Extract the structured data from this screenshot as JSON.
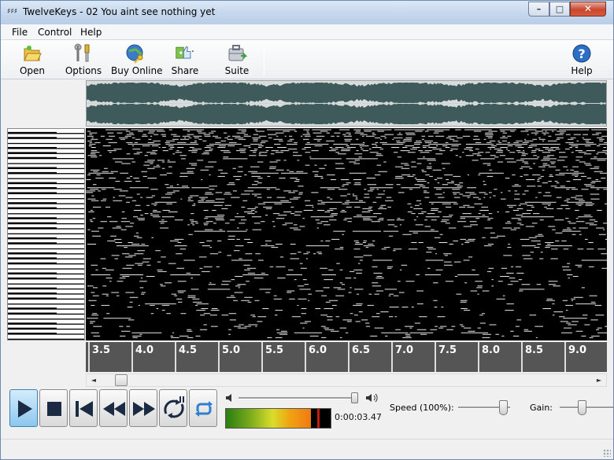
{
  "window": {
    "title": "TwelveKeys - 02 You aint see nothing yet",
    "app_icon_text": "♯♯♯",
    "minimize_glyph": "–",
    "maximize_glyph": "□",
    "close_glyph": "✕"
  },
  "menu": [
    "File",
    "Control",
    "Help"
  ],
  "toolbar": {
    "open": "Open",
    "options": "Options",
    "buy_online": "Buy Online",
    "share": "Share",
    "suite": "Suite",
    "help": "Help",
    "icons": [
      "folder-open-icon",
      "wrench-icon",
      "globe-key-icon",
      "thumbs-up-icon",
      "toolbox-icon",
      "help-icon"
    ]
  },
  "timeline": {
    "labels": [
      "3.5",
      "4.0",
      "4.5",
      "5.0",
      "5.5",
      "6.0",
      "6.5",
      "7.0",
      "7.5",
      "8.0",
      "8.5",
      "9.0"
    ]
  },
  "scroll": {
    "left_arrow": "◄",
    "right_arrow": "►",
    "position_fraction": 0.03
  },
  "transport": {
    "buttons": [
      "play",
      "stop",
      "skip-back",
      "rewind",
      "fast-forward",
      "loop-section",
      "repeat"
    ]
  },
  "volume": {
    "level_fraction": 0.95
  },
  "meter": {
    "level_fraction": 0.81,
    "peak_fraction": 0.87
  },
  "playback": {
    "time": "0:00:03.47"
  },
  "speed": {
    "label": "Speed (100%):",
    "value_percent": 100
  },
  "gain": {
    "label": "Gain:"
  },
  "colors": {
    "waveform": "#3e5a5a",
    "waveform_bg": "#d9dcdc",
    "notes_bg": "#000000",
    "timeline_bg": "#555555",
    "accent": "#3c7fb1"
  }
}
